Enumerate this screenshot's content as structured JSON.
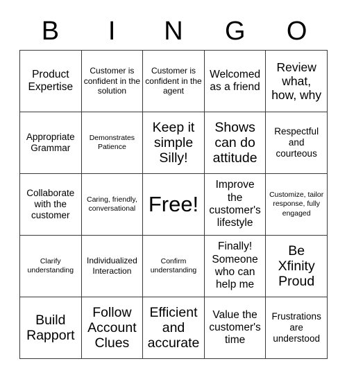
{
  "card": {
    "title": "BINGO Card",
    "header_letters": [
      "B",
      "I",
      "N",
      "G",
      "O"
    ],
    "columns": 5,
    "rows": 5,
    "border_color": "#3a3a3a",
    "background_color": "#ffffff",
    "text_color": "#000000",
    "free_space": {
      "label": "Free!",
      "row": 3,
      "column": 3
    },
    "cells": [
      {
        "text": "Product Expertise",
        "size": "l",
        "row": 1,
        "col": 1
      },
      {
        "text": "Customer is confident in the solution",
        "size": "s",
        "row": 1,
        "col": 2
      },
      {
        "text": "Customer is confident in the agent",
        "size": "s",
        "row": 1,
        "col": 3
      },
      {
        "text": "Welcomed as a friend",
        "size": "l",
        "row": 1,
        "col": 4
      },
      {
        "text": "Review what, how, why",
        "size": "xl",
        "row": 1,
        "col": 5
      },
      {
        "text": "Appropriate Grammar",
        "size": "m",
        "row": 2,
        "col": 1
      },
      {
        "text": "Demonstrates Patience",
        "size": "xs",
        "row": 2,
        "col": 2
      },
      {
        "text": "Keep it simple Silly!",
        "size": "xxl",
        "row": 2,
        "col": 3
      },
      {
        "text": "Shows can do attitude",
        "size": "xxl",
        "row": 2,
        "col": 4
      },
      {
        "text": "Respectful and courteous",
        "size": "m",
        "row": 2,
        "col": 5
      },
      {
        "text": "Collaborate with the customer",
        "size": "m",
        "row": 3,
        "col": 1
      },
      {
        "text": "Caring, friendly, conversational",
        "size": "xs",
        "row": 3,
        "col": 2
      },
      {
        "text": "Free!",
        "size": "free",
        "row": 3,
        "col": 3
      },
      {
        "text": "Improve the customer's lifestyle",
        "size": "l",
        "row": 3,
        "col": 4
      },
      {
        "text": "Customize, tailor response, fully engaged",
        "size": "xs",
        "row": 3,
        "col": 5
      },
      {
        "text": "Clarify understanding",
        "size": "xs",
        "row": 4,
        "col": 1
      },
      {
        "text": "Individualized Interaction",
        "size": "s",
        "row": 4,
        "col": 2
      },
      {
        "text": "Confirm understanding",
        "size": "xs",
        "row": 4,
        "col": 3
      },
      {
        "text": "Finally! Someone who can help me",
        "size": "l",
        "row": 4,
        "col": 4
      },
      {
        "text": "Be Xfinity Proud",
        "size": "xxl",
        "row": 4,
        "col": 5
      },
      {
        "text": "Build Rapport",
        "size": "xxl",
        "row": 5,
        "col": 1
      },
      {
        "text": "Follow Account Clues",
        "size": "xxl",
        "row": 5,
        "col": 2
      },
      {
        "text": "Efficient and accurate",
        "size": "xxl",
        "row": 5,
        "col": 3
      },
      {
        "text": "Value the customer's time",
        "size": "l",
        "row": 5,
        "col": 4
      },
      {
        "text": "Frustrations are understood",
        "size": "m",
        "row": 5,
        "col": 5
      }
    ]
  }
}
